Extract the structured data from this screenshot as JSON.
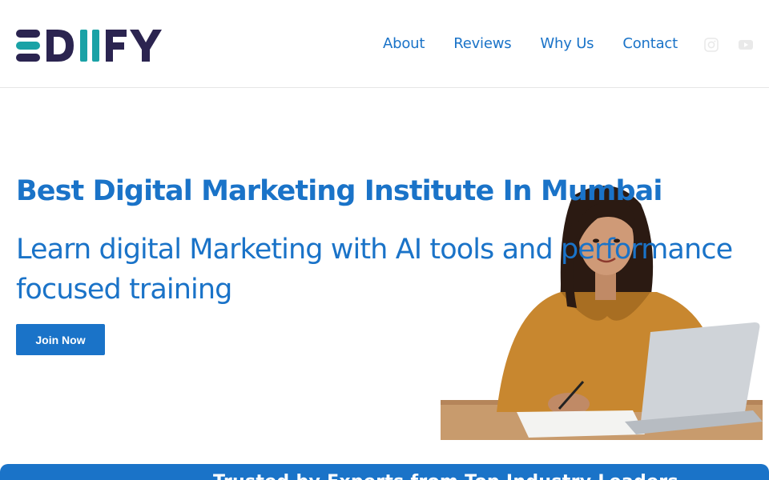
{
  "brand": {
    "logo_text": "EDIIFY",
    "logo_dark": "#2b2450",
    "logo_teal": "#1aa2a6"
  },
  "nav": {
    "items": [
      {
        "label": "About"
      },
      {
        "label": "Reviews"
      },
      {
        "label": "Why Us"
      },
      {
        "label": "Contact"
      }
    ]
  },
  "social": {
    "icons": [
      "instagram-icon",
      "youtube-icon"
    ]
  },
  "hero": {
    "title": "Best Digital Marketing Institute In Mumbai",
    "subtitle": "Learn digital Marketing with AI tools and performance focused training",
    "cta_label": "Join Now",
    "image": "woman-with-laptop-photo"
  },
  "banner": {
    "text": "Trusted by Experts from Top Industry Leaders"
  },
  "colors": {
    "accent": "#1a73c8",
    "background": "#ffffff"
  }
}
